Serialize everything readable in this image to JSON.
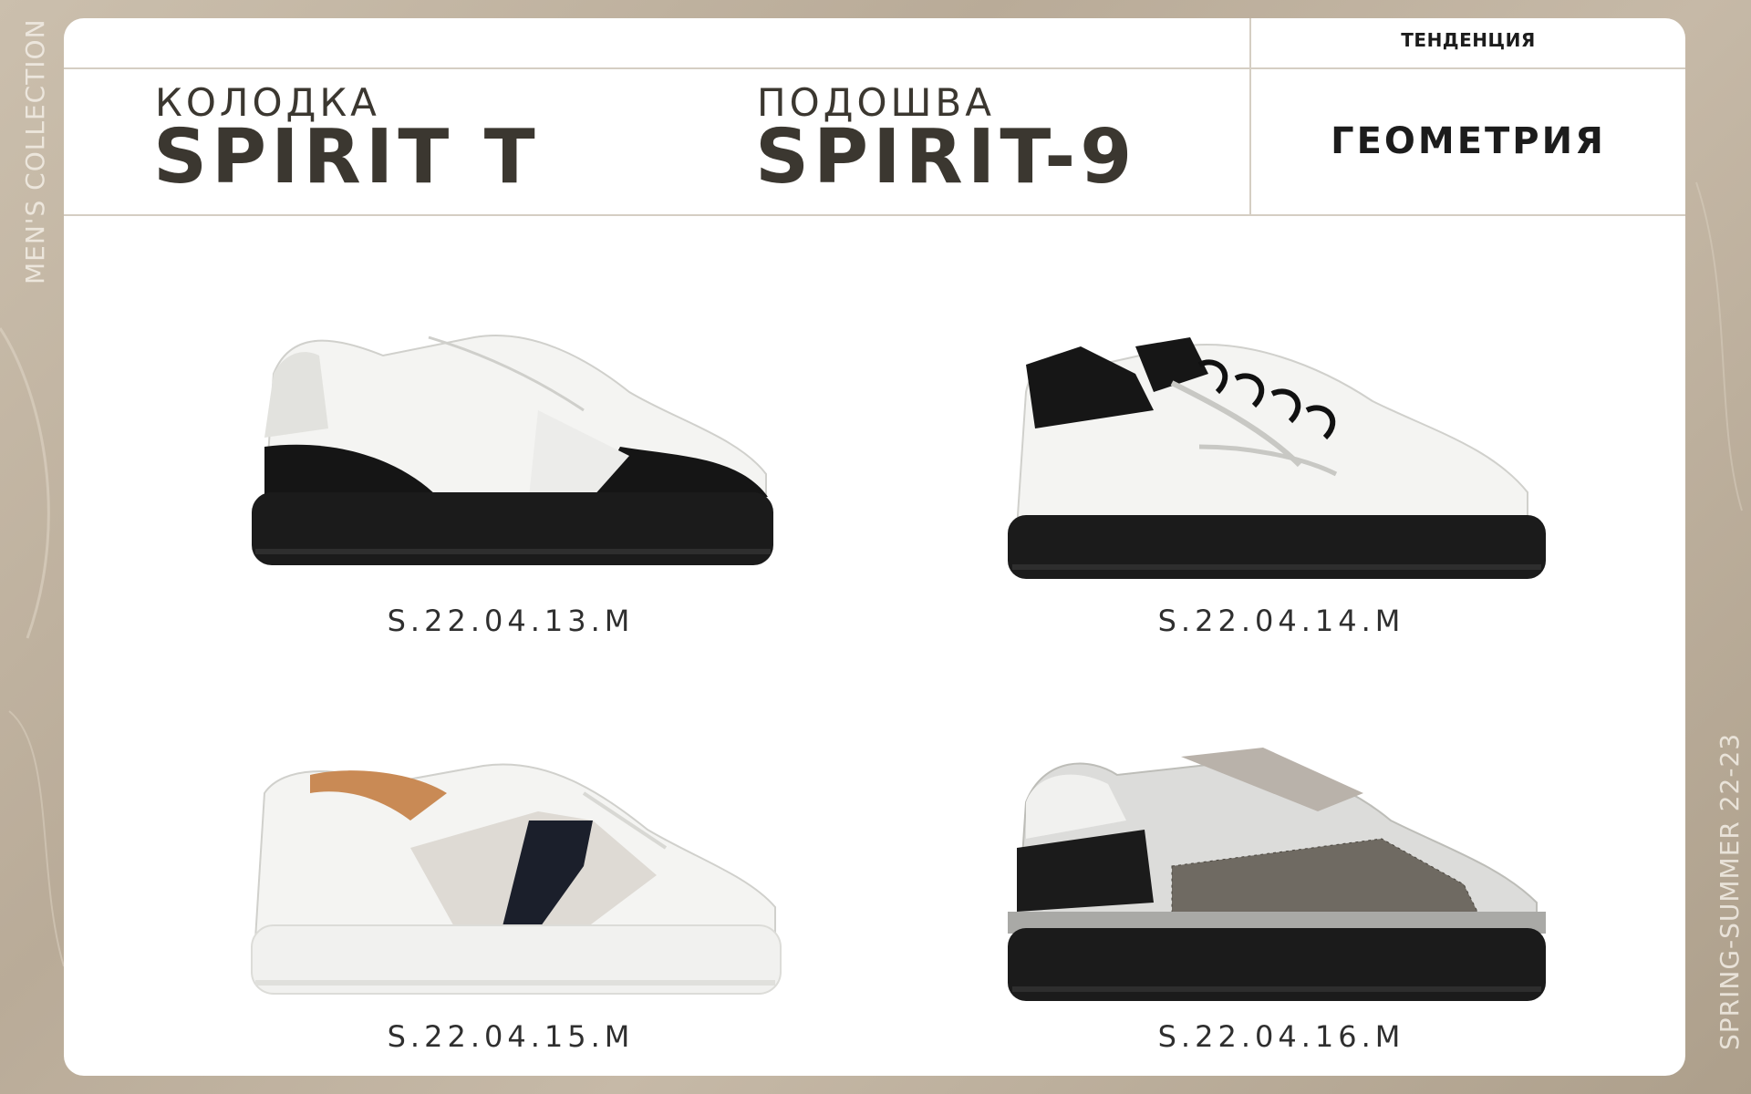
{
  "side_texts": {
    "left": "MEN'S COLLECTION",
    "right": "SPRING-SUMMER 22-23"
  },
  "header": {
    "last": {
      "label": "КОЛОДКА",
      "value": "SPIRIT T"
    },
    "sole": {
      "label": "ПОДОШВА",
      "value": "SPIRIT-9"
    },
    "trend": {
      "label": "ТЕНДЕНЦИЯ",
      "value": "ГЕОМЕТРИЯ"
    }
  },
  "products": [
    {
      "sku": "S.22.04.13.M",
      "icon": "white-black-sneaker"
    },
    {
      "sku": "S.22.04.14.M",
      "icon": "white-sneaker-black-laces"
    },
    {
      "sku": "S.22.04.15.M",
      "icon": "white-suede-sneaker-white-sole"
    },
    {
      "sku": "S.22.04.16.M",
      "icon": "grey-mesh-sneaker"
    }
  ],
  "colors": {
    "text_dark": "#3b3730",
    "divider": "#d5cec3",
    "sole_black": "#1b1b1b",
    "leather_white": "#f4f4f2"
  }
}
